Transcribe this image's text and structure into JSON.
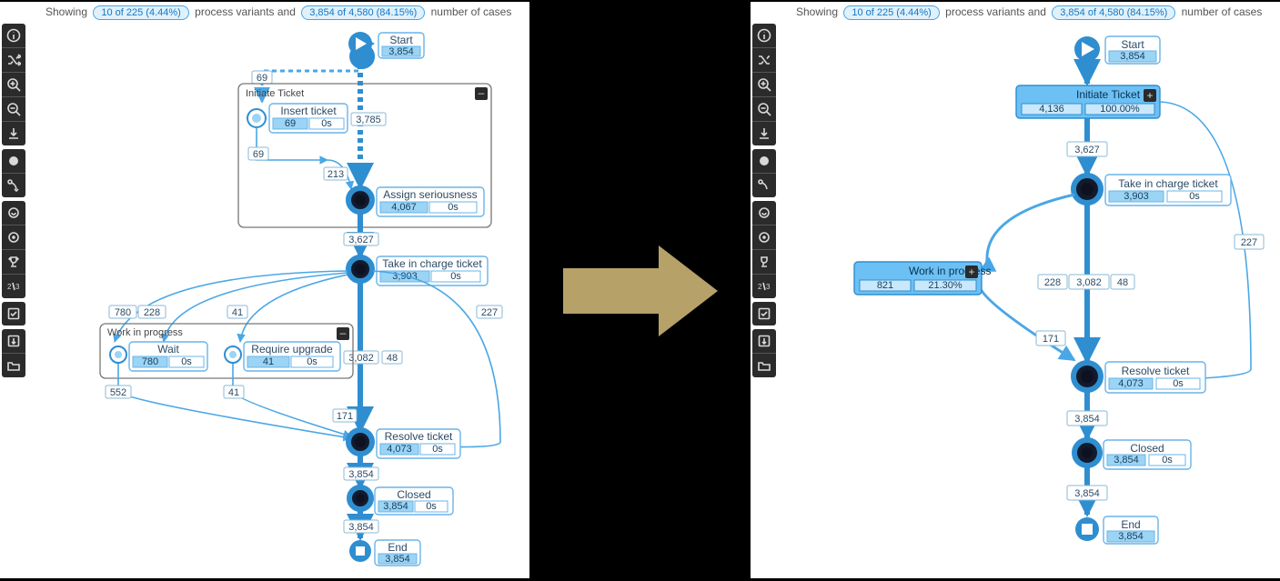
{
  "banner": {
    "prefix": "Showing",
    "variants_pill": "10 of 225 (4.44%)",
    "mid": "process variants and",
    "cases_pill": "3,854 of 4,580 (84.15%)",
    "suffix": "number of cases"
  },
  "toolbar": {
    "groups": [
      [
        "info-icon",
        "shuffle-icon",
        "zoom-in-icon",
        "zoom-out-icon",
        "download-svg-icon"
      ],
      [
        "circle-icon",
        "connector-icon"
      ],
      [
        "hide-self-loop-icon",
        "hide-end-icon",
        "trophy-icon",
        "two-three-icon"
      ],
      [
        "checkbox-icon"
      ],
      [
        "export-icon",
        "folder-icon"
      ]
    ]
  },
  "left": {
    "start": {
      "label": "Start",
      "count": "3,854"
    },
    "edge_start_inner": "69",
    "sub_initiate": {
      "title": "Initiate Ticket",
      "insert": {
        "label": "Insert ticket",
        "v1": "69",
        "v2": "0s"
      },
      "edge_insert_across": "3,785",
      "edge_down": "69",
      "edge_mid": "213",
      "assign": {
        "label": "Assign seriousness",
        "v1": "4,067",
        "v2": "0s"
      }
    },
    "edge_to_take": "3,627",
    "take": {
      "label": "Take in charge ticket",
      "v1": "3,903",
      "v2": "0s"
    },
    "edge_take_780": "780",
    "edge_take_228": "228",
    "edge_take_41": "41",
    "edge_take_3082": "3,082",
    "edge_take_48": "48",
    "edge_take_227": "227",
    "sub_wip": {
      "title": "Work in progress",
      "wait": {
        "label": "Wait",
        "v1": "780",
        "v2": "0s"
      },
      "upgrade": {
        "label": "Require upgrade",
        "v1": "41",
        "v2": "0s"
      }
    },
    "edge_552": "552",
    "edge_41b": "41",
    "edge_171": "171",
    "resolve": {
      "label": "Resolve ticket",
      "v1": "4,073",
      "v2": "0s"
    },
    "edge_resolve_closed": "3,854",
    "closed": {
      "label": "Closed",
      "v1": "3,854",
      "v2": "0s"
    },
    "edge_closed_end": "3,854",
    "end": {
      "label": "End",
      "count": "3,854"
    }
  },
  "right": {
    "start": {
      "label": "Start",
      "count": "3,854"
    },
    "initiate": {
      "label": "Initiate Ticket",
      "v1": "4,136",
      "v2": "100.00%"
    },
    "edge_init_take": "3,627",
    "take": {
      "label": "Take in charge ticket",
      "v1": "3,903",
      "v2": "0s"
    },
    "edge_227": "227",
    "wip": {
      "label": "Work in progress",
      "v1": "821",
      "v2": "21.30%"
    },
    "edge_228": "228",
    "edge_3082": "3,082",
    "edge_48": "48",
    "edge_171": "171",
    "resolve": {
      "label": "Resolve ticket",
      "v1": "4,073",
      "v2": "0s"
    },
    "edge_res_cl": "3,854",
    "closed": {
      "label": "Closed",
      "v1": "3,854",
      "v2": "0s"
    },
    "edge_cl_end": "3,854",
    "end": {
      "label": "End",
      "count": "3,854"
    }
  }
}
